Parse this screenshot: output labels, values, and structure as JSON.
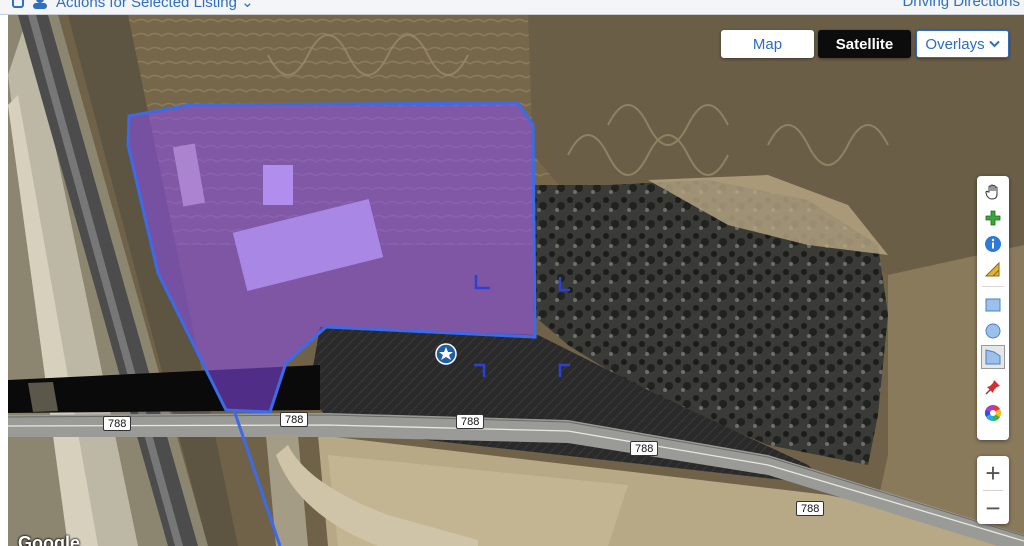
{
  "topbar": {
    "actions_label": "Actions for Selected Listing",
    "driving_directions_label": "Driving Directions",
    "caret": "⌄"
  },
  "map": {
    "type_controls": {
      "map_label": "Map",
      "satellite_label": "Satellite",
      "overlays_label": "Overlays",
      "selected": "Satellite"
    },
    "drawing_tools": [
      {
        "name": "hand-pan-icon"
      },
      {
        "name": "add-plus-icon"
      },
      {
        "name": "info-icon"
      },
      {
        "name": "measure-ruler-icon"
      },
      {
        "name": "draw-rectangle-icon"
      },
      {
        "name": "draw-circle-icon"
      },
      {
        "name": "draw-polygon-icon",
        "active": true
      },
      {
        "name": "pushpin-icon"
      },
      {
        "name": "color-wheel-icon"
      }
    ],
    "zoom": {
      "in_label": "+",
      "out_label": "−"
    },
    "road_shields": [
      "788",
      "788",
      "788",
      "788",
      "788"
    ],
    "attribution": "Google",
    "colors": {
      "accent": "#2d6cc0",
      "polygon_fill": "#8a4cf0",
      "polygon_stroke": "#3d6be8",
      "satellite_button": "#0c0c0c"
    }
  }
}
